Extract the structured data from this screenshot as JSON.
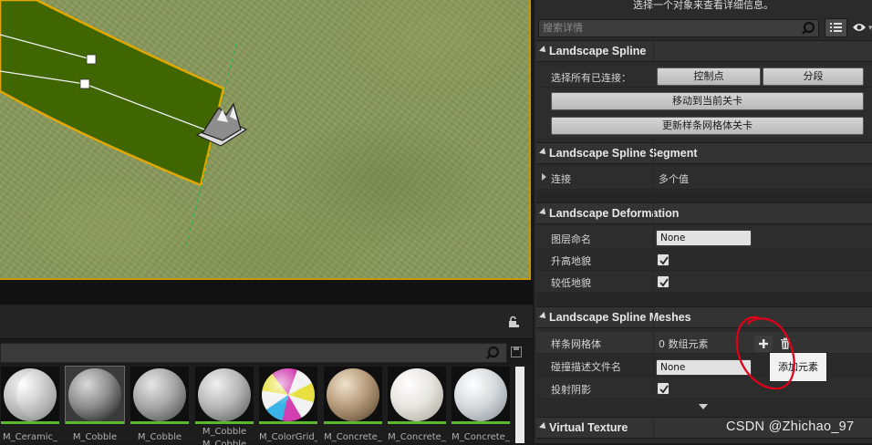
{
  "details": {
    "hint": "选择一个对象来查看详细信息。",
    "search_placeholder": "搜索详情",
    "categories": {
      "landscape_spline": "Landscape Spline",
      "spline_segment": "Landscape Spline Segment",
      "deformation": "Landscape Deformation",
      "spline_meshes": "Landscape Spline Meshes",
      "virtual_texture": "Virtual Texture"
    },
    "select_all_connected_label": "选择所有已连接：",
    "control_points_button": "控制点",
    "segments_button": "分段",
    "move_to_current_level_button": "移动到当前关卡",
    "update_spline_mesh_levels_button": "更新样条网格体关卡",
    "segment": {
      "connections_label": "连接",
      "connections_value": "多个值"
    },
    "deformation": {
      "layer_name_label": "图层命名",
      "layer_name_value": "None",
      "raise_terrain_label": "升高地貌",
      "raise_terrain_checked": true,
      "lower_terrain_label": "较低地貌",
      "lower_terrain_checked": true
    },
    "spline_meshes": {
      "spline_meshes_label": "样条网格体",
      "spline_meshes_value": "0 数组元素",
      "collision_profile_label": "碰撞描述文件名",
      "collision_profile_value": "None",
      "cast_shadow_label": "投射阴影",
      "cast_shadow_checked": true,
      "add_element_tooltip": "添加元素"
    }
  },
  "content_browser": {
    "assets": [
      {
        "label": "M_Ceramic_",
        "selected": false,
        "style": "ceramic"
      },
      {
        "label": "M_Cobble",
        "selected": true,
        "style": "cobble"
      },
      {
        "label": "M_Cobble",
        "selected": false,
        "style": "cobble2"
      },
      {
        "label": "M_Cobble",
        "label2": "M_Cobble",
        "selected": false,
        "style": "cobble3"
      },
      {
        "label": "M_ColorGrid_",
        "selected": false,
        "style": "colorgrid"
      },
      {
        "label": "M_Concrete_",
        "selected": false,
        "style": "concrete_brown"
      },
      {
        "label": "M_Concrete_",
        "selected": false,
        "style": "concrete_white"
      },
      {
        "label": "M_Concrete_",
        "selected": false,
        "style": "concrete_grey"
      }
    ]
  },
  "colors": {
    "viewport_border": "#c89a00",
    "spline_road": "#3f6600",
    "asset_bar": "#5cb82d",
    "annotation": "#e0001a"
  },
  "watermark": "CSDN @Zhichao_97"
}
